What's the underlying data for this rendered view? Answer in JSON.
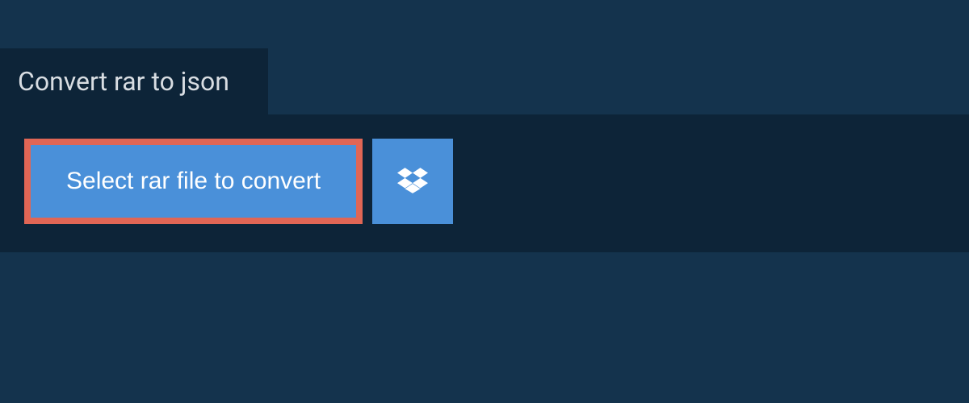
{
  "tab": {
    "title": "Convert rar to json"
  },
  "actions": {
    "select_file_label": "Select rar file to convert",
    "dropbox_icon": "dropbox-icon"
  },
  "colors": {
    "page_bg": "#14334d",
    "panel_bg": "#0d2438",
    "button_bg": "#4a90d9",
    "highlight_border": "#e06655",
    "text_light": "#d8dde2",
    "text_white": "#ffffff"
  }
}
